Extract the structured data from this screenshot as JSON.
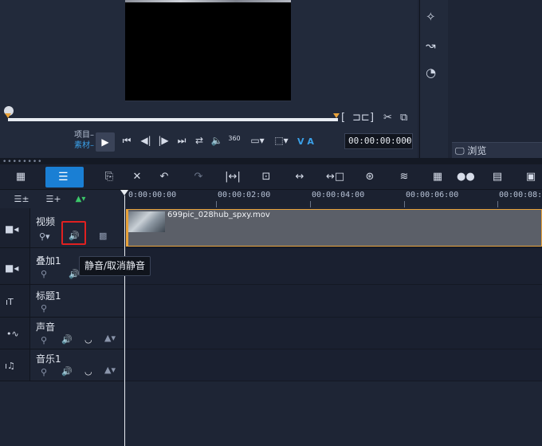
{
  "player": {
    "project_label": "项目",
    "clip_label": "素材",
    "va_label": "V A",
    "timecode": "00:00:00:000"
  },
  "library": {
    "browse_label": "浏览"
  },
  "ruler": {
    "ticks": [
      "0:00:00:00",
      "00:00:02:00",
      "00:00:04:00",
      "00:00:06:00",
      "00:00:08:0"
    ]
  },
  "tracks": [
    {
      "name": "视频",
      "icon": "video-track-icon"
    },
    {
      "name": "叠加1",
      "icon": "overlay-track-icon"
    },
    {
      "name": "标题1",
      "icon": "title-track-icon"
    },
    {
      "name": "声音",
      "icon": "voice-track-icon"
    },
    {
      "name": "音乐1",
      "icon": "music-track-icon"
    }
  ],
  "clip": {
    "filename": "699pic_028hub_spxy.mov"
  },
  "tooltip": {
    "text": "静音/取消静音"
  },
  "colors": {
    "accent": "#1a7fd4",
    "clip_border": "#e8a23a",
    "highlight": "#e02020"
  }
}
